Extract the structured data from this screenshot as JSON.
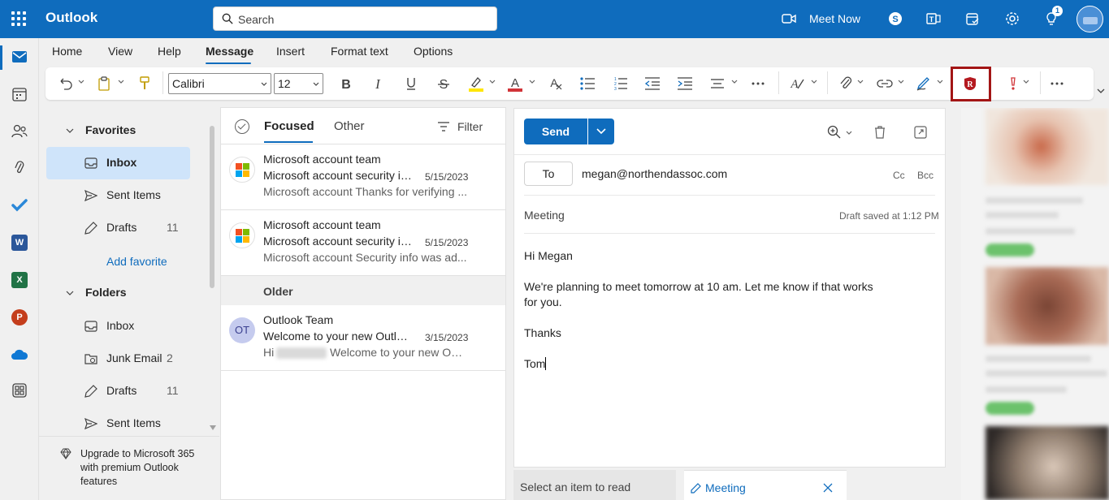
{
  "app": {
    "name": "Outlook",
    "search_placeholder": "Search",
    "meet_now": "Meet Now",
    "notification_count": "1",
    "brand_color": "#0f6cbd"
  },
  "rail": {
    "items": [
      "mail-icon",
      "calendar-icon",
      "people-icon",
      "attachment-icon",
      "todo-icon",
      "word-icon",
      "excel-icon",
      "powerpoint-icon",
      "onedrive-icon",
      "more-apps-icon"
    ],
    "word": "W",
    "excel": "X",
    "powerpoint": "P"
  },
  "tabs": [
    "Home",
    "View",
    "Help",
    "Message",
    "Insert",
    "Format text",
    "Options"
  ],
  "active_tab": "Message",
  "toolbar": {
    "font": "Calibri",
    "size": "12",
    "highlight_color": "#ffe600",
    "font_color": "#d13438"
  },
  "folders": {
    "favorites_header": "Favorites",
    "favorites": [
      {
        "label": "Inbox",
        "count": ""
      },
      {
        "label": "Sent Items",
        "count": ""
      },
      {
        "label": "Drafts",
        "count": "11"
      }
    ],
    "add_favorite": "Add favorite",
    "folders_header": "Folders",
    "folders": [
      {
        "label": "Inbox",
        "count": ""
      },
      {
        "label": "Junk Email",
        "count": "2"
      },
      {
        "label": "Drafts",
        "count": "11"
      },
      {
        "label": "Sent Items",
        "count": ""
      }
    ],
    "upgrade": "Upgrade to Microsoft 365 with premium Outlook features"
  },
  "message_list": {
    "focused": "Focused",
    "other": "Other",
    "filter": "Filter",
    "group_older": "Older",
    "messages": [
      {
        "from": "Microsoft account team",
        "subject": "Microsoft account security info was added",
        "date": "5/15/2023",
        "preview": "Microsoft account Thanks for verifying ..."
      },
      {
        "from": "Microsoft account team",
        "subject": "Microsoft account security info was added",
        "date": "5/15/2023",
        "preview": "Microsoft account Security info was ad..."
      },
      {
        "from": "Outlook Team",
        "initials": "OT",
        "subject": "Welcome to your new Outlook.com account",
        "date": "3/15/2023",
        "preview_start": "Hi",
        "preview_end": "Welcome to your new Outlo..."
      }
    ]
  },
  "compose": {
    "send": "Send",
    "to_label": "To",
    "to_address": "megan@northendassoc.com",
    "cc": "Cc",
    "bcc": "Bcc",
    "subject": "Meeting",
    "draft_status": "Draft saved at 1:12 PM",
    "body": [
      "Hi Megan",
      "We're planning to meet tomorrow at 10 am. Let me know if that works for you.",
      "Thanks",
      "Tom"
    ]
  },
  "bottom_tabs": {
    "read": "Select an item to read",
    "draft": "Meeting"
  }
}
